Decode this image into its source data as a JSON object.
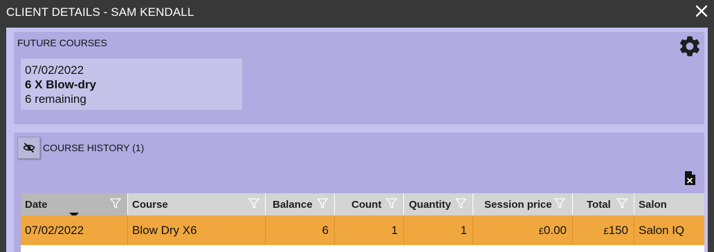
{
  "window": {
    "title": "CLIENT DETAILS - SAM KENDALL"
  },
  "future_courses": {
    "heading": "FUTURE COURSES",
    "items": [
      {
        "date": "07/02/2022",
        "name": "6 X Blow-dry",
        "remaining": "6 remaining"
      }
    ]
  },
  "course_history": {
    "heading": "COURSE HISTORY (1)",
    "columns": [
      "Date",
      "Course",
      "Balance",
      "Count",
      "Quantity",
      "Session price",
      "Total",
      "Salon"
    ],
    "rows": [
      {
        "date": "07/02/2022",
        "course": "Blow Dry X6",
        "balance": "6",
        "count": "1",
        "quantity": "1",
        "session_price_currency": "£",
        "session_price": "0.00",
        "total_currency": "£",
        "total": "150",
        "salon": "Salon IQ"
      }
    ]
  },
  "colors": {
    "title_bar": "#383838",
    "panel": "#b1abe1",
    "panel_border": "#c6c2f0",
    "selected_row": "#f0a83e",
    "grid_header": "#d4d4d4"
  },
  "icons": {
    "close": "close-icon",
    "settings": "gear-icon",
    "visibility": "eye-off-icon",
    "export": "excel-file-icon",
    "filter": "filter-icon"
  }
}
